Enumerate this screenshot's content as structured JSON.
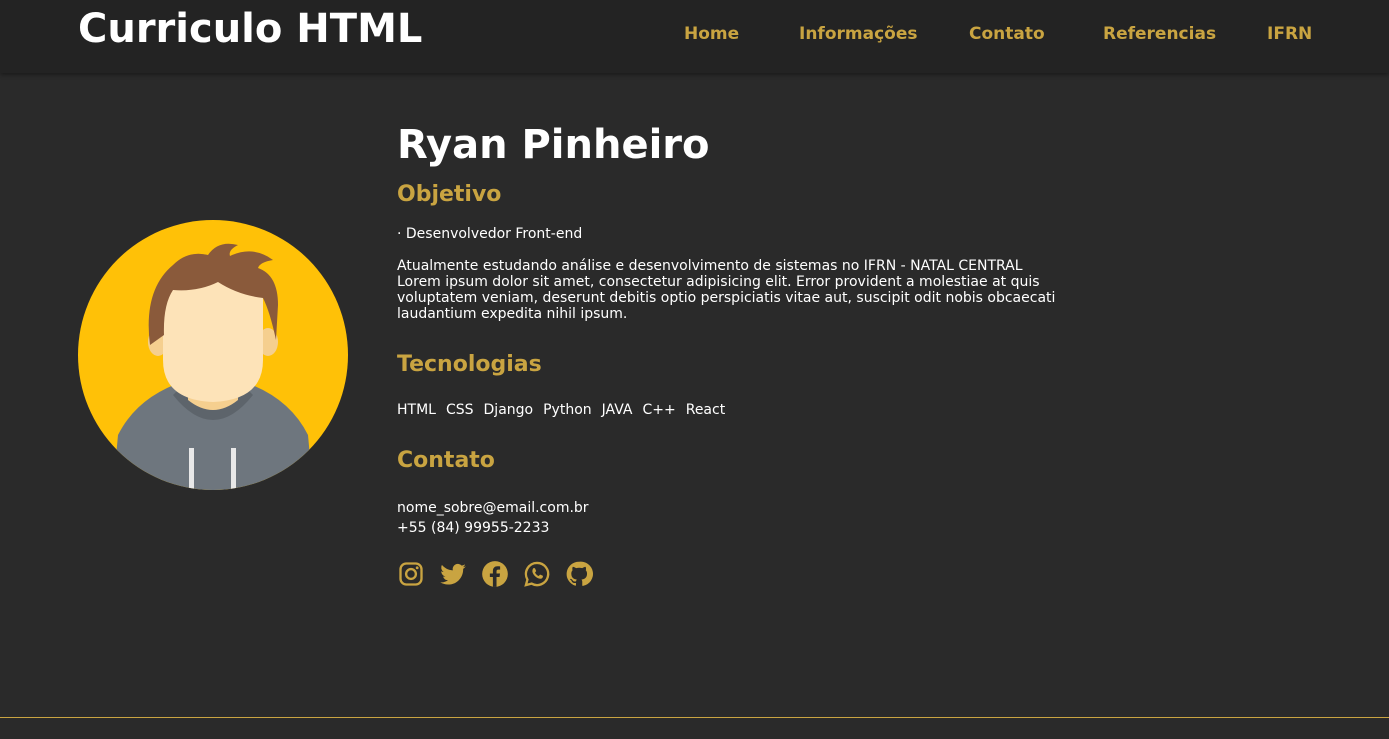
{
  "header": {
    "title": "Curriculo HTML",
    "nav": [
      "Home",
      "Informações",
      "Contato",
      "Referencias",
      "IFRN"
    ]
  },
  "profile": {
    "name": "Ryan Pinheiro",
    "objective_heading": "Objetivo",
    "objective_item": "· Desenvolvedor Front-end",
    "about_line1": "Atualmente estudando análise e desenvolvimento de sistemas no IFRN - NATAL CENTRAL",
    "about_line2": "Lorem ipsum dolor sit amet, consectetur adipisicing elit. Error provident a molestiae at quis voluptatem veniam, deserunt debitis optio perspiciatis vitae aut, suscipit odit nobis obcaecati laudantium expedita nihil ipsum.",
    "tech_heading": "Tecnologias",
    "technologies": [
      "HTML",
      "CSS",
      "Django",
      "Python",
      "JAVA",
      "C++",
      "React"
    ],
    "contact_heading": "Contato",
    "email": "nome_sobre@email.com.br",
    "phone": "+55 (84) 99955-2233",
    "social_icons": [
      "instagram-icon",
      "twitter-icon",
      "facebook-icon",
      "whatsapp-icon",
      "github-icon"
    ]
  },
  "colors": {
    "background": "#2a2a2a",
    "header_bg": "#232323",
    "accent": "#c9a441",
    "text": "#ffffff",
    "avatar_bg": "#ffc107"
  }
}
